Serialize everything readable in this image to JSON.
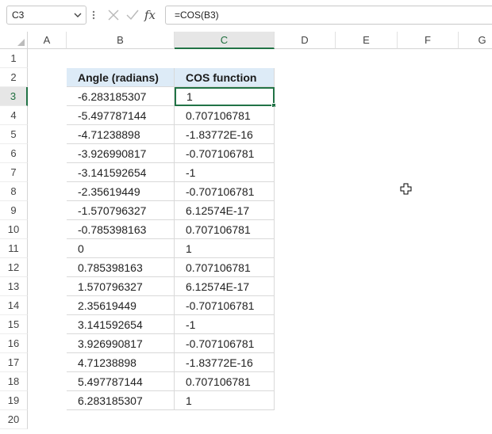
{
  "formula_bar": {
    "name_box": "C3",
    "fx_label": "fx",
    "formula": "=COS(B3)"
  },
  "columns": [
    "A",
    "B",
    "C",
    "D",
    "E",
    "F",
    "G"
  ],
  "rows": [
    "1",
    "2",
    "3",
    "4",
    "5",
    "6",
    "7",
    "8",
    "9",
    "10",
    "11",
    "12",
    "13",
    "14",
    "15",
    "16",
    "17",
    "18",
    "19",
    "20"
  ],
  "table": {
    "headers": [
      "Angle (radians)",
      "COS function"
    ],
    "rows": [
      [
        "-6.283185307",
        "1"
      ],
      [
        "-5.497787144",
        "0.707106781"
      ],
      [
        "-4.71238898",
        "-1.83772E-16"
      ],
      [
        "-3.926990817",
        "-0.707106781"
      ],
      [
        "-3.141592654",
        "-1"
      ],
      [
        "-2.35619449",
        "-0.707106781"
      ],
      [
        "-1.570796327",
        "6.12574E-17"
      ],
      [
        "-0.785398163",
        "0.707106781"
      ],
      [
        "0",
        "1"
      ],
      [
        "0.785398163",
        "0.707106781"
      ],
      [
        "1.570796327",
        "6.12574E-17"
      ],
      [
        "2.35619449",
        "-0.707106781"
      ],
      [
        "3.141592654",
        "-1"
      ],
      [
        "3.926990817",
        "-0.707106781"
      ],
      [
        "4.71238898",
        "-1.83772E-16"
      ],
      [
        "5.497787144",
        "0.707106781"
      ],
      [
        "6.283185307",
        "1"
      ]
    ]
  },
  "active_cell": {
    "column": "C",
    "row": "3"
  },
  "colors": {
    "header_fill": "#ddebf7",
    "selection": "#217346",
    "gridline": "#d9d9d9"
  },
  "icons": [
    "chevron-down-icon",
    "cancel-icon",
    "enter-icon",
    "fx-icon",
    "select-all-icon",
    "cell-cursor-icon"
  ]
}
